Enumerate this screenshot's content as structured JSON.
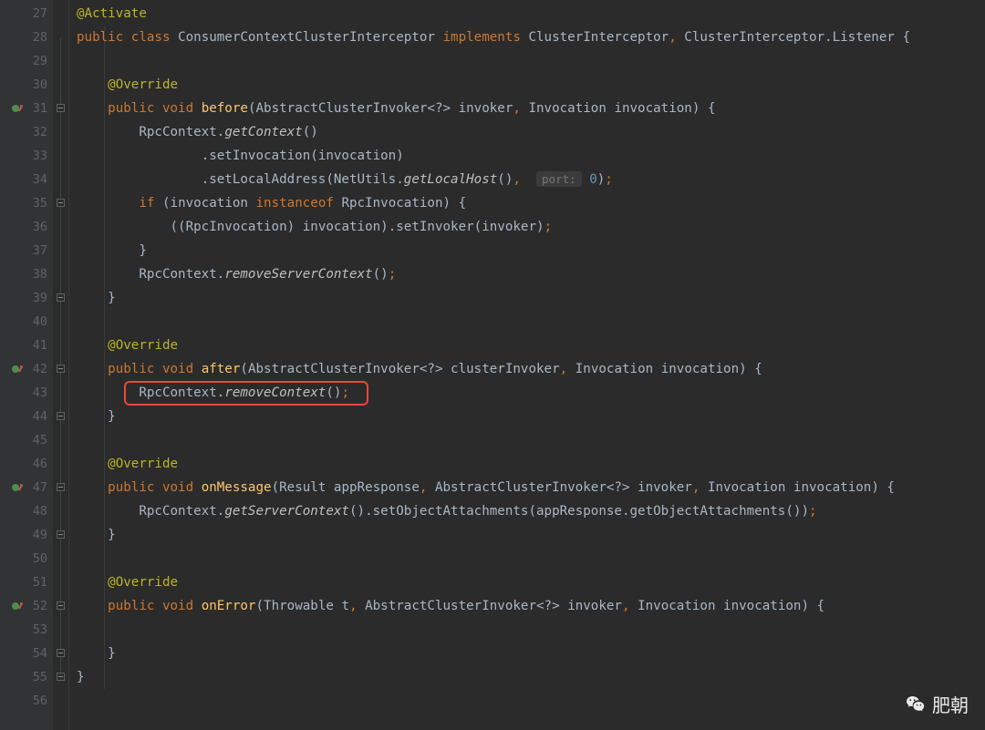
{
  "watermark": "肥朝",
  "lineNumbers": [
    "27",
    "28",
    "29",
    "30",
    "31",
    "32",
    "33",
    "34",
    "35",
    "36",
    "37",
    "38",
    "39",
    "40",
    "41",
    "42",
    "43",
    "44",
    "45",
    "46",
    "47",
    "48",
    "49",
    "50",
    "51",
    "52",
    "53",
    "54",
    "55",
    "56"
  ],
  "markers": {
    "31": "impl-up",
    "42": "impl-up",
    "47": "impl-up",
    "52": "impl-up"
  },
  "tokens": {
    "annotation_activate": "@Activate",
    "kw_public": "public",
    "kw_class": "class",
    "cls_name": "ConsumerContextClusterInterceptor",
    "kw_implements": "implements",
    "if_cluster": "ClusterInterceptor",
    "if_listener": "ClusterInterceptor.Listener",
    "annotation_override": "@Override",
    "kw_void": "void",
    "mth_before": "before",
    "type_abstract_invoker": "AbstractClusterInvoker<?>",
    "param_invoker": "invoker",
    "type_invocation": "Invocation",
    "param_invocation": "invocation",
    "cls_rpc": "RpcContext",
    "call_getContext": "getContext",
    "call_setInvocation": "setInvocation",
    "call_setLocalAddress": "setLocalAddress",
    "cls_netutils": "NetUtils",
    "call_getLocalHost": "getLocalHost",
    "hint_port": "port:",
    "num_zero": "0",
    "kw_if": "if",
    "kw_instanceof": "instanceof",
    "cls_rpcinv": "RpcInvocation",
    "call_setInvoker": "setInvoker",
    "call_removeServerContext": "removeServerContext",
    "mth_after": "after",
    "param_clusterInvoker": "clusterInvoker",
    "call_removeContext": "removeContext",
    "mth_onMessage": "onMessage",
    "type_result": "Result",
    "param_appResponse": "appResponse",
    "call_getServerContext": "getServerContext",
    "call_setObjectAttachments": "setObjectAttachments",
    "call_getObjectAttachments": "getObjectAttachments",
    "mth_onError": "onError",
    "type_throwable": "Throwable",
    "param_t": "t"
  }
}
